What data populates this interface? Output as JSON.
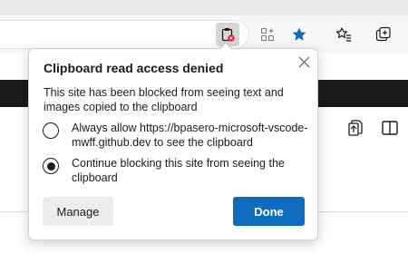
{
  "toolbar": {
    "icons": [
      "clipboard-blocked-icon",
      "collections-icon",
      "favorite-star-icon",
      "favorites-icon",
      "collections-add-icon"
    ],
    "accent_color": "#0f6cbd",
    "blocked_color": "#e81123"
  },
  "popup": {
    "title": "Clipboard read access denied",
    "description": "This site has been blocked from seeing text and images copied to the clipboard",
    "options": [
      {
        "label": "Always allow https://bpasero-microsoft-vscode-mwff.github.dev to see the clipboard",
        "selected": false
      },
      {
        "label": "Continue blocking this site from seeing the clipboard",
        "selected": true
      }
    ],
    "manage_label": "Manage",
    "done_label": "Done"
  }
}
